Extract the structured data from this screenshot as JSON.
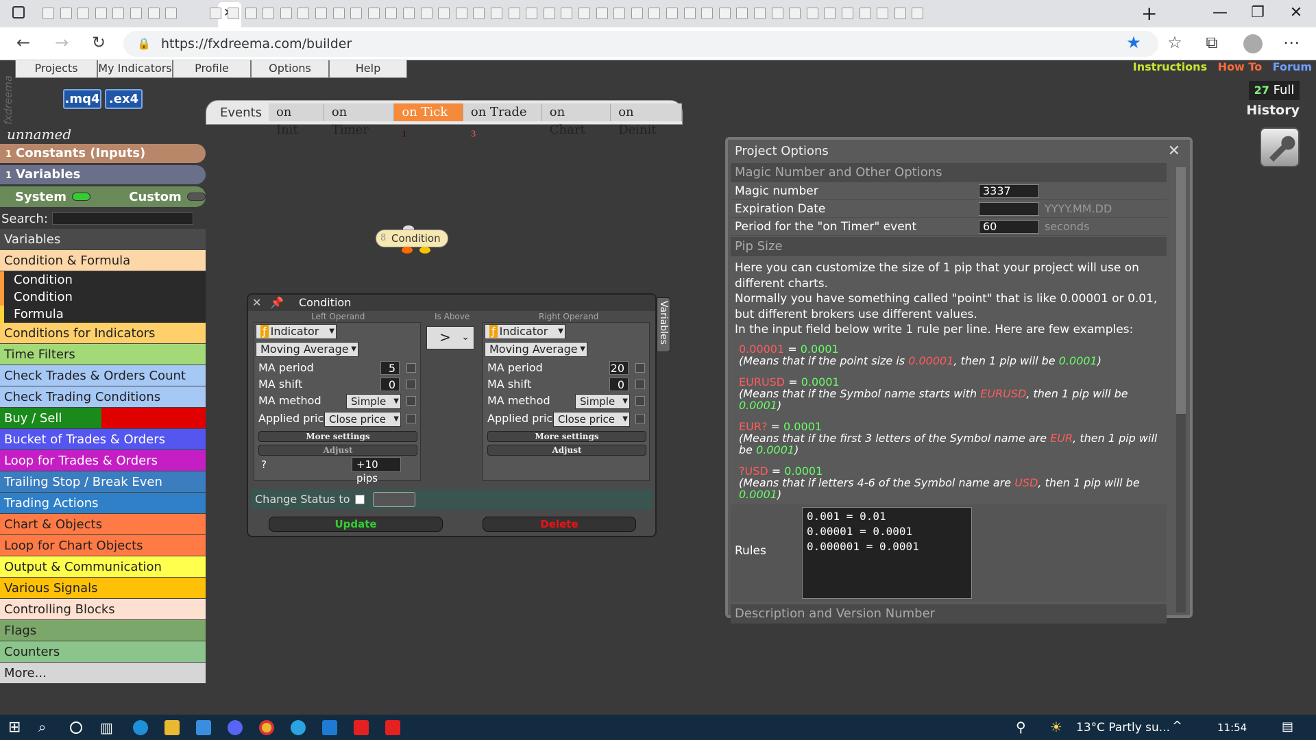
{
  "browser": {
    "url": "https://fxdreema.com/builder",
    "close_tab": "✕",
    "new_tab": "+",
    "window": {
      "minimize": "—",
      "maximize": "❐",
      "close": "✕"
    }
  },
  "menubar": {
    "items": [
      "Projects",
      "My Indicators",
      "Profile",
      "Options",
      "Help"
    ],
    "top_links": {
      "instructions": "Instructions",
      "howto": "How To",
      "forum": "Forum"
    },
    "full_count": "27",
    "full_label": "Full",
    "history": "History",
    "logo": "fxdreema"
  },
  "export": {
    "mq4": ".mq4",
    "ex4": ".ex4"
  },
  "events": {
    "label": "Events",
    "tabs": [
      {
        "label": "on Init",
        "badge": ""
      },
      {
        "label": "on Timer",
        "badge": ""
      },
      {
        "label": "on Tick",
        "badge": "1"
      },
      {
        "label": "on Trade",
        "badge": "3"
      },
      {
        "label": "on Chart",
        "badge": ""
      },
      {
        "label": "on Deinit",
        "badge": ""
      }
    ]
  },
  "sidebar": {
    "project_name": "unnamed",
    "constants": {
      "count": "1",
      "label": "Constants (Inputs)"
    },
    "variables": {
      "count": "1",
      "label": "Variables"
    },
    "system": "System",
    "custom": "Custom",
    "search_label": "Search:",
    "categories": [
      {
        "label": "Variables",
        "color": "#4a4a4a",
        "text": "#eeeeee"
      },
      {
        "label": "Condition & Formula",
        "color": "#fdd7a8",
        "text": "#222222"
      },
      {
        "label": "Conditions for Indicators",
        "color": "#ffcf6a",
        "text": "#222222"
      },
      {
        "label": "Time Filters",
        "color": "#a3d977",
        "text": "#222222"
      },
      {
        "label": "Check Trades & Orders Count",
        "color": "#a6c8f5",
        "text": "#222222"
      },
      {
        "label": "Check Trading Conditions",
        "color": "#a6c8f5",
        "text": "#222222"
      },
      {
        "label": "Buy / Sell",
        "color": "#1a8a1a",
        "text": "#ffffff"
      },
      {
        "label": "Bucket of Trades & Orders",
        "color": "#5555f0",
        "text": "#ffffff"
      },
      {
        "label": "Loop for Trades & Orders",
        "color": "#c51ec5",
        "text": "#ffffff"
      },
      {
        "label": "Trailing Stop / Break Even",
        "color": "#3a7ec0",
        "text": "#ffffff"
      },
      {
        "label": "Trading Actions",
        "color": "#2f80c8",
        "text": "#ffffff"
      },
      {
        "label": "Chart & Objects",
        "color": "#ff7a45",
        "text": "#222222"
      },
      {
        "label": "Loop for Chart Objects",
        "color": "#ff7a45",
        "text": "#222222"
      },
      {
        "label": "Output & Communication",
        "color": "#ffff4d",
        "text": "#222222"
      },
      {
        "label": "Various Signals",
        "color": "#ffc107",
        "text": "#222222"
      },
      {
        "label": "Controlling Blocks",
        "color": "#fde0d0",
        "text": "#222222"
      },
      {
        "label": "Flags",
        "color": "#7ba86a",
        "text": "#222222"
      },
      {
        "label": "Counters",
        "color": "#8bc58b",
        "text": "#222222"
      },
      {
        "label": "More...",
        "color": "#d6d6d6",
        "text": "#222222"
      }
    ],
    "subitems": [
      "Condition",
      "Condition",
      "Formula"
    ]
  },
  "node": {
    "number": "8",
    "label": "Condition"
  },
  "condition_dialog": {
    "title": "Condition",
    "vertical_tab": "Variables",
    "left_label": "Left Operand",
    "mid_label": "Is Above",
    "right_label": "Right Operand",
    "operator": ">",
    "left": {
      "type": "Indicator",
      "indicator": "Moving Average",
      "params": [
        {
          "name": "MA period",
          "value": "5"
        },
        {
          "name": "MA shift",
          "value": "0"
        },
        {
          "name": "MA method",
          "value": "Simple"
        },
        {
          "name": "Applied price",
          "value": "Close price"
        }
      ],
      "more": "More settings",
      "adjust": "Adjust",
      "adjust_q": "?",
      "adjust_val": "+10 pips"
    },
    "right": {
      "type": "Indicator",
      "indicator": "Moving Average",
      "params": [
        {
          "name": "MA period",
          "value": "20"
        },
        {
          "name": "MA shift",
          "value": "0"
        },
        {
          "name": "MA method",
          "value": "Simple"
        },
        {
          "name": "Applied price",
          "value": "Close price"
        }
      ],
      "more": "More settings",
      "adjust": "Adjust"
    },
    "change_status": "Change Status to",
    "update": "Update",
    "delete": "Delete"
  },
  "project_options": {
    "title": "Project Options",
    "sec_magic": "Magic Number and Other Options",
    "magic_label": "Magic number",
    "magic_value": "3337",
    "expiry_label": "Expiration Date",
    "expiry_hint": "YYYY.MM.DD",
    "timer_label": "Period for the \"on Timer\" event",
    "timer_value": "60",
    "timer_hint": "seconds",
    "sec_pip": "Pip Size",
    "pip_p1": "Here you can customize the size of 1 pip that your project will use on different charts.",
    "pip_p2": "Normally you have something called \"point\" that is like 0.00001 or 0.01, but different brokers use different values.",
    "pip_p3": "In the input field below write 1 rule per line. Here are few examples:",
    "ex1": {
      "lhs": "0.00001",
      "rhs": "0.0001",
      "t1": "(Means that if the point size is ",
      "v1": "0.00001",
      "t2": ", then 1 pip will be ",
      "v2": "0.0001",
      "t3": ")"
    },
    "ex2": {
      "lhs": "EURUSD",
      "rhs": "0.0001",
      "t1": "(Means that if the Symbol name starts with ",
      "v1": "EURUSD",
      "t2": ", then 1 pip will be ",
      "v2": "0.0001",
      "t3": ")"
    },
    "ex3": {
      "lhs": "EUR?",
      "rhs": "0.0001",
      "t1": "(Means that if the first 3 letters of the Symbol name are ",
      "v1": "EUR",
      "t2": ", then 1 pip will be ",
      "v2": "0.0001",
      "t3": ")"
    },
    "ex4": {
      "lhs": "?USD",
      "rhs": "0.0001",
      "t1": "(Means that if letters 4-6 of the Symbol name are ",
      "v1": "USD",
      "t2": ", then 1 pip will be ",
      "v2": "0.0001",
      "t3": ")"
    },
    "rules_label": "Rules",
    "rules_text": "0.001 = 0.01\n0.00001 = 0.0001\n0.000001 = 0.0001",
    "sec_desc": "Description and Version Number"
  },
  "taskbar": {
    "weather": "13°C  Partly su...",
    "time": "11:54"
  }
}
